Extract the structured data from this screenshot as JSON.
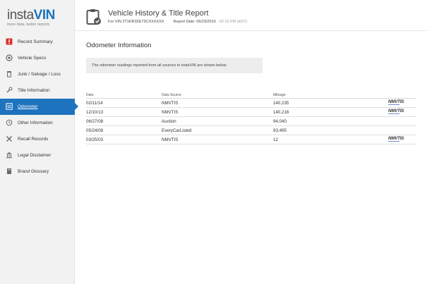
{
  "sidebar": {
    "logo_brand_a": "insta",
    "logo_brand_b": "VIN",
    "logo_tagline": "more data, better reports",
    "items": [
      {
        "label": "Record Summary",
        "icon": "alert-icon"
      },
      {
        "label": "Vehicle Specs",
        "icon": "gauge-icon"
      },
      {
        "label": "Junk / Salvage / Loss",
        "icon": "trash-icon"
      },
      {
        "label": "Title Information",
        "icon": "wrench-icon"
      },
      {
        "label": "Odometer",
        "icon": "odometer-icon"
      },
      {
        "label": "Other Information",
        "icon": "history-icon"
      },
      {
        "label": "Recall Records",
        "icon": "tools-icon"
      },
      {
        "label": "Legal Disclaimer",
        "icon": "bank-icon"
      },
      {
        "label": "Brand Glossary",
        "icon": "book-icon"
      }
    ],
    "active_index": 4,
    "accent_color": "#1e73be"
  },
  "header": {
    "title": "Vehicle History & Title Report",
    "vin_label": "For VIN 2T1KR32E73CXXXXXX",
    "report_date": "Report Date: 06/23/2016",
    "report_time": "- 02:10 PM (EDT)"
  },
  "main": {
    "section_title": "Odometer Information",
    "notice": "The odometer readings reported from all sources to instaVIN are shown below.",
    "columns": [
      "Date",
      "Data Source",
      "Mileage"
    ],
    "rows": [
      {
        "date": "02/11/14",
        "source": "NMVTIS",
        "mileage": "140,235",
        "logo": "NMVTIS"
      },
      {
        "date": "12/10/13",
        "source": "NMVTIS",
        "mileage": "140,216",
        "logo": "NMVTIS"
      },
      {
        "date": "06/27/08",
        "source": "Auction",
        "mileage": "94,040",
        "logo": ""
      },
      {
        "date": "05/24/08",
        "source": "EveryCarListed",
        "mileage": "93,495",
        "logo": ""
      },
      {
        "date": "03/25/03",
        "source": "NMVTIS",
        "mileage": "12",
        "logo": "NMVTIS"
      }
    ]
  }
}
